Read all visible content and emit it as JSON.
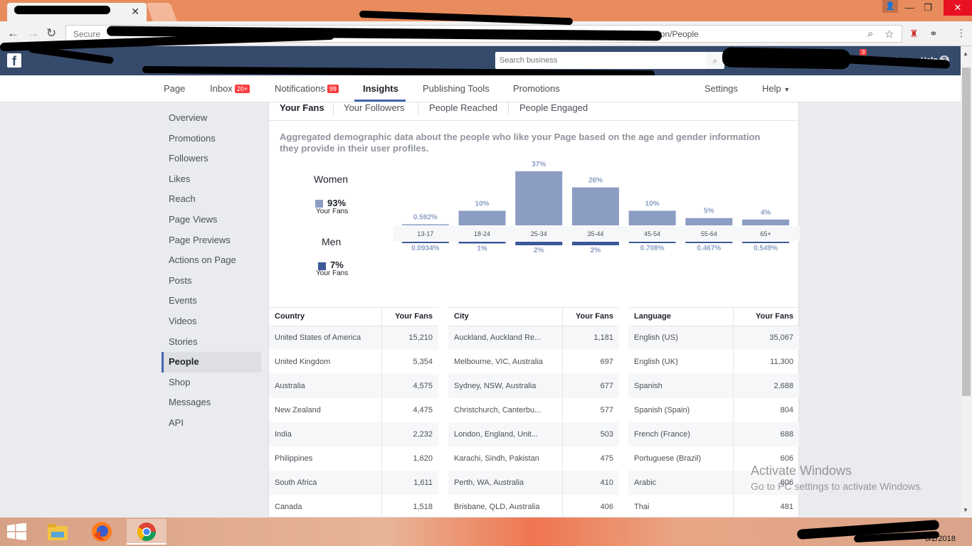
{
  "browser": {
    "address_prefix": "Secure",
    "address_tail": "1632854610918/section/People",
    "window_controls": [
      "—",
      "❐",
      "✕"
    ]
  },
  "fb": {
    "search_placeholder": "Search business",
    "notif_count": "3",
    "help_label": "Help"
  },
  "pagenav": {
    "page": "Page",
    "inbox": "Inbox",
    "inbox_badge": "20+",
    "notifications": "Notifications",
    "notifications_badge": "99",
    "insights": "Insights",
    "publishing_tools": "Publishing Tools",
    "promotions": "Promotions",
    "settings": "Settings",
    "help": "Help"
  },
  "sidebar": {
    "items": [
      "Overview",
      "Promotions",
      "Followers",
      "Likes",
      "Reach",
      "Page Views",
      "Page Previews",
      "Actions on Page",
      "Posts",
      "Events",
      "Videos",
      "Stories",
      "People",
      "Shop",
      "Messages",
      "API"
    ],
    "active": "People"
  },
  "subtabs": [
    "Your Fans",
    "Your Followers",
    "People Reached",
    "People Engaged"
  ],
  "description": "Aggregated demographic data about the people who like your Page based on the age and gender information they provide in their user profiles.",
  "legend": {
    "women_label": "Women",
    "women_pct": "93%",
    "women_sub": "Your Fans",
    "men_label": "Men",
    "men_pct": "7%",
    "men_sub": "Your Fans"
  },
  "chart_data": {
    "type": "bar",
    "categories": [
      "13-17",
      "18-24",
      "25-34",
      "35-44",
      "45-54",
      "55-64",
      "65+"
    ],
    "series": [
      {
        "name": "Women",
        "values": [
          0.592,
          10,
          37,
          26,
          10,
          5,
          4
        ],
        "labels": [
          "0.592%",
          "10%",
          "37%",
          "26%",
          "10%",
          "5%",
          "4%"
        ]
      },
      {
        "name": "Men",
        "values": [
          0.0934,
          1,
          2,
          2,
          0.708,
          0.467,
          0.549
        ],
        "labels": [
          "0.0934%",
          "1%",
          "2%",
          "2%",
          "0.708%",
          "0.467%",
          "0.549%"
        ]
      }
    ],
    "colors": {
      "women": "#8b9dc3",
      "men": "#3b5998"
    }
  },
  "tables": {
    "country": {
      "headers": [
        "Country",
        "Your Fans"
      ],
      "rows": [
        [
          "United States of America",
          "15,210"
        ],
        [
          "United Kingdom",
          "5,354"
        ],
        [
          "Australia",
          "4,575"
        ],
        [
          "New Zealand",
          "4,475"
        ],
        [
          "India",
          "2,232"
        ],
        [
          "Philippines",
          "1,620"
        ],
        [
          "South Africa",
          "1,611"
        ],
        [
          "Canada",
          "1,518"
        ]
      ]
    },
    "city": {
      "headers": [
        "City",
        "Your Fans"
      ],
      "rows": [
        [
          "Auckland, Auckland Re...",
          "1,181"
        ],
        [
          "Melbourne, VIC, Australia",
          "697"
        ],
        [
          "Sydney, NSW, Australia",
          "677"
        ],
        [
          "Christchurch, Canterbu...",
          "577"
        ],
        [
          "London, England, Unit...",
          "503"
        ],
        [
          "Karachi, Sindh, Pakistan",
          "475"
        ],
        [
          "Perth, WA, Australia",
          "410"
        ],
        [
          "Brisbane, QLD, Australia",
          "406"
        ]
      ]
    },
    "language": {
      "headers": [
        "Language",
        "Your Fans"
      ],
      "rows": [
        [
          "English (US)",
          "35,067"
        ],
        [
          "English (UK)",
          "11,300"
        ],
        [
          "Spanish",
          "2,688"
        ],
        [
          "Spanish (Spain)",
          "804"
        ],
        [
          "French (France)",
          "688"
        ],
        [
          "Portuguese (Brazil)",
          "606"
        ],
        [
          "Arabic",
          "606"
        ],
        [
          "Thai",
          "481"
        ]
      ]
    }
  },
  "watermark": {
    "title": "Activate Windows",
    "subtitle": "Go to PC settings to activate Windows."
  },
  "taskbar": {
    "date": "6/2/2018"
  }
}
